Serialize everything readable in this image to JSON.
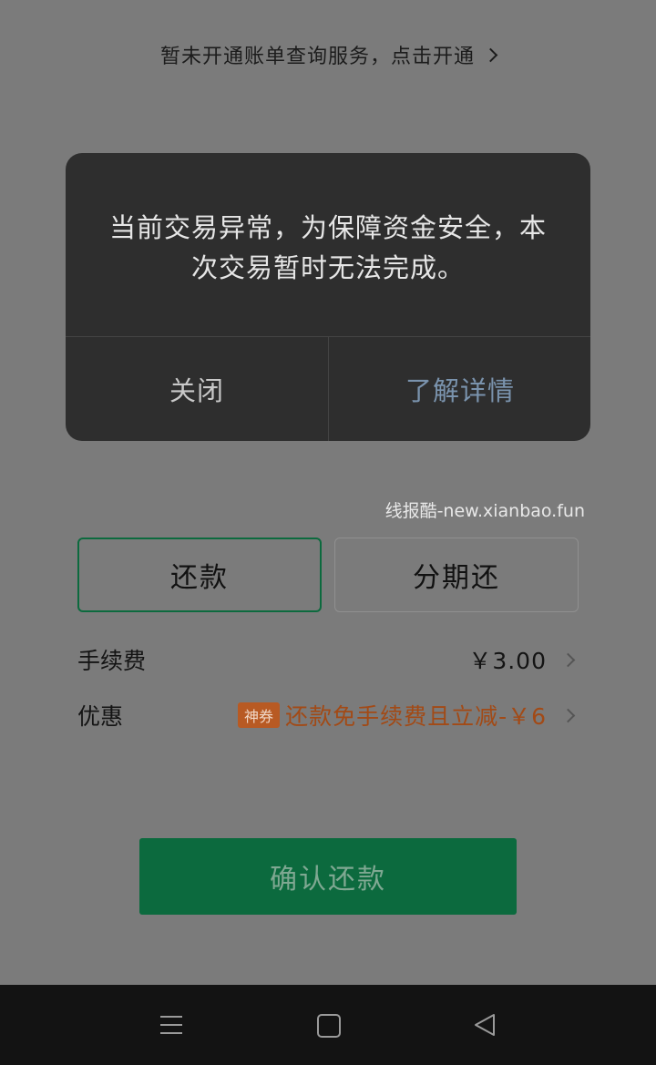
{
  "header": {
    "billing_link": "暂未开通账单查询服务，点击开通"
  },
  "dialog": {
    "message": "当前交易异常，为保障资金安全，本次交易暂时无法完成。",
    "close_label": "关闭",
    "detail_label": "了解详情"
  },
  "watermark": "线报酷-new.xianbao.fun",
  "options": {
    "repay_label": "还款",
    "installment_label": "分期还"
  },
  "fee": {
    "label": "手续费",
    "value": "￥3.00"
  },
  "promo": {
    "label": "优惠",
    "badge": "神券",
    "text": "还款免手续费且立减-￥6"
  },
  "confirm_label": "确认还款",
  "nav": {
    "menu_icon": "menu-icon",
    "home_icon": "home-icon",
    "back_icon": "back-icon"
  },
  "colors": {
    "accent_green": "#0c6a3e",
    "promo_orange": "#b85a23"
  }
}
